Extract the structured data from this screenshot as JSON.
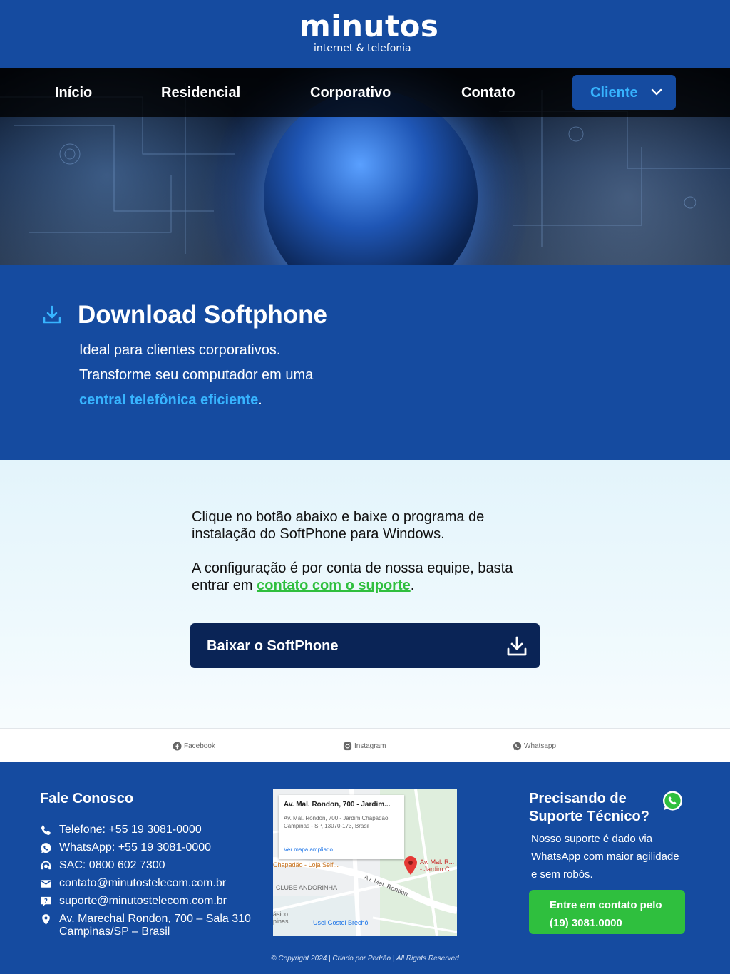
{
  "header": {
    "logo_main": "minutos",
    "logo_sub": "internet & telefonia"
  },
  "nav": {
    "items": [
      {
        "label": "Início"
      },
      {
        "label": "Residencial"
      },
      {
        "label": "Corporativo"
      },
      {
        "label": "Contato"
      }
    ],
    "client_label": "Cliente"
  },
  "band": {
    "title": "Download Softphone",
    "line1": "Ideal para clientes corporativos.",
    "line2": "Transforme seu computador em uma",
    "highlight": "central telefônica eficiente",
    "highlight_suffix": "."
  },
  "content": {
    "para1": "Clique no botão abaixo e baixe o programa de instalação do SoftPhone para Windows.",
    "para2_prefix": "A configuração é por conta de nossa equipe, basta entrar em ",
    "para2_link": "contato com o suporte",
    "para2_suffix": ".",
    "download_button": "Baixar o SoftPhone"
  },
  "social": {
    "facebook": "Facebook",
    "instagram": "Instagram",
    "whatsapp": "Whatsapp"
  },
  "footer": {
    "title": "Fale Conosco",
    "phone": "Telefone: +55 19 3081-0000",
    "whatsapp": "WhatsApp: +55 19 3081-0000",
    "sac": "SAC: 0800 602 7300",
    "email_contact": "contato@minutostelecom.com.br",
    "email_support": "suporte@minutostelecom.com.br",
    "address_line1": "Av. Marechal Rondon, 700 – Sala 310",
    "address_line2": "Campinas/SP – Brasil",
    "map": {
      "card_title": "Av. Mal. Rondon, 700 - Jardim...",
      "card_address": "Av. Mal. Rondon, 700 - Jardim Chapadão, Campinas - SP, 13070-173, Brasil",
      "card_link": "Ver mapa ampliado",
      "label_pin": "Av. Mal. R... - Jardim C...",
      "label_store": "Chapadão - Loja Self...",
      "label_street": "Av. Mal. Rondon",
      "label_club": "CLUBE ANDORINHA",
      "label_basico": "ásico pinas",
      "label_brecho": "Usei Gostei Brechó"
    },
    "support_title": "Precisando de Suporte Técnico?",
    "support_text": "Nosso suporte é dado via WhatsApp com maior agilidade e sem robôs.",
    "support_button": "Entre em contato pelo (19) 3081.0000",
    "copyright": "© Copyright 2024 | Criado por Pedrão | All Rights Reserved"
  },
  "colors": {
    "brand_blue": "#154ba0",
    "accent_cyan": "#37b4ff",
    "dark_navy": "#0a2456",
    "green": "#2fbf3e"
  }
}
